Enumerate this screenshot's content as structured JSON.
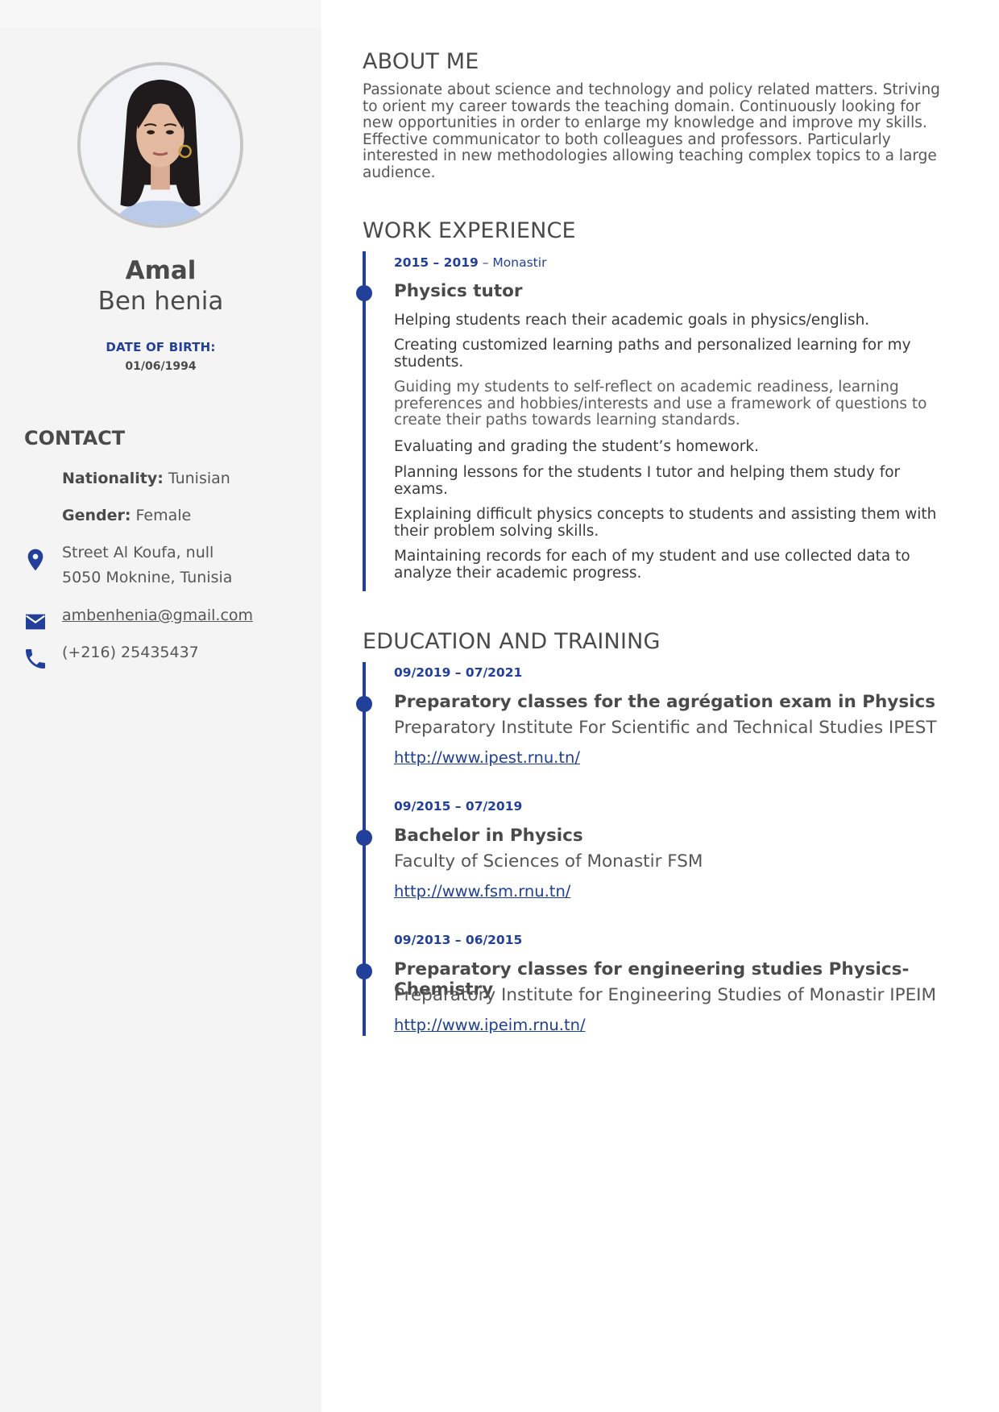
{
  "profile": {
    "first_name": "Amal",
    "last_name": "Ben henia",
    "dob_label": "DATE OF BIRTH:",
    "dob_value": "01/06/1994"
  },
  "contact": {
    "heading": "CONTACT",
    "nationality_label": "Nationality:",
    "nationality_value": "Tunisian",
    "gender_label": "Gender:",
    "gender_value": "Female",
    "address_line1": "Street Al Koufa, null",
    "address_line2": "5050 Moknine, Tunisia",
    "email": "ambenhenia@gmail.com",
    "phone": "(+216) 25435437",
    "icons": [
      "location-pin-icon",
      "envelope-icon",
      "phone-icon"
    ]
  },
  "about": {
    "title": "ABOUT ME",
    "lines": [
      "Passionate about science and technology and policy related matters. Striving",
      "to orient my career towards the teaching domain. Continuously looking for",
      "new opportunities in order to enlarge my knowledge and improve my skills.",
      "Effective communicator to both colleagues and professors. Particularly",
      "interested in new methodologies allowing teaching complex topics to a large",
      "audience."
    ]
  },
  "work": {
    "title": "WORK EXPERIENCE",
    "date": "2015 – 2019",
    "place": " – Monastir",
    "job_title": "Physics tutor",
    "bullets": [
      [
        "Helping students reach their academic goals in physics/english."
      ],
      [
        "Creating customized learning paths and personalized learning for my",
        "students."
      ],
      [
        "Guiding my students to self-reflect on academic readiness, learning",
        "preferences and hobbies/interests and use a framework of questions to",
        "create their paths towards learning standards."
      ],
      [
        "Evaluating and grading the student’s homework."
      ],
      [
        "Planning lessons for the students I tutor and helping them study for",
        "exams."
      ],
      [
        "Explaining difficult physics concepts to students and assisting them with",
        "their problem solving skills."
      ],
      [
        "Maintaining records for each of my student and use collected data to",
        "analyze their academic progress."
      ]
    ]
  },
  "education": {
    "title": "EDUCATION AND TRAINING",
    "items": [
      {
        "date": "09/2019 – 07/2021",
        "title": "Preparatory classes for the agrégation exam in Physics",
        "org": "Preparatory Institute For Scientific and Technical Studies IPEST",
        "link": "http://www.ipest.rnu.tn/"
      },
      {
        "date": "09/2015 – 07/2019",
        "title": "Bachelor in Physics",
        "org": "Faculty of Sciences of Monastir FSM",
        "link": "http://www.fsm.rnu.tn/"
      },
      {
        "date": "09/2013 – 06/2015",
        "title": "Preparatory classes for engineering studies Physics-Chemistry",
        "org": "Preparatory Institute for Engineering Studies of Monastir IPEIM",
        "link": "http://www.ipeim.rnu.tn/"
      }
    ]
  },
  "colors": {
    "accent": "#22409a",
    "sidebar_bg": "#f4f4f4",
    "text": "#4a4a4a"
  }
}
